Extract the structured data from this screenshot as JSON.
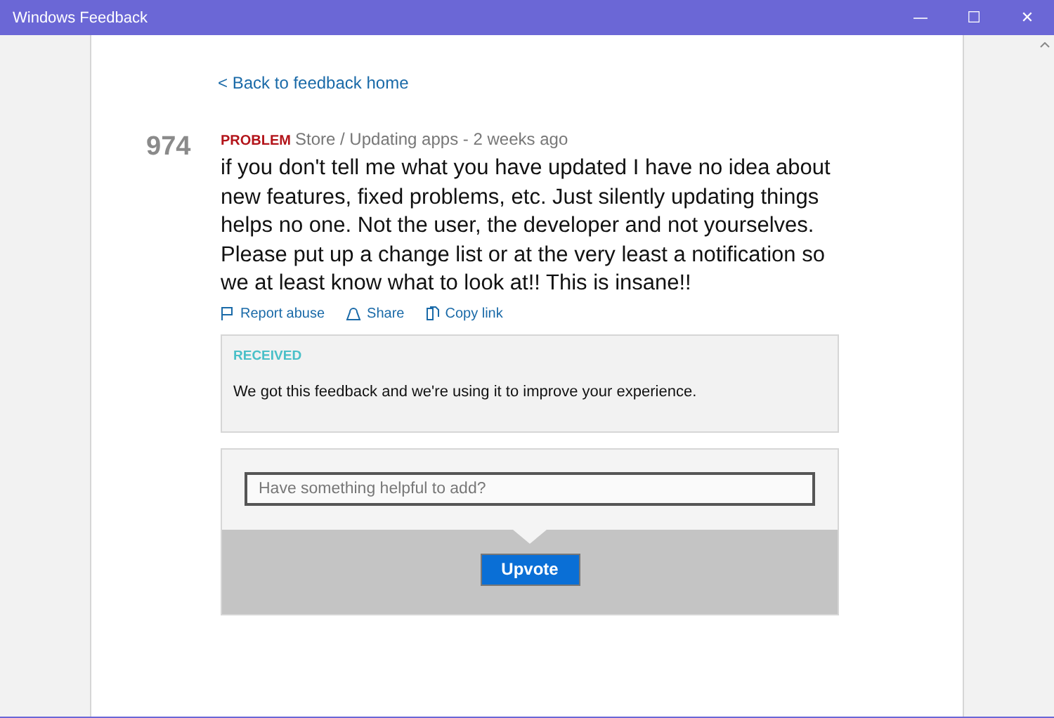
{
  "window": {
    "title": "Windows Feedback",
    "controls": [
      "—",
      "☐",
      "✕"
    ]
  },
  "back_link": "< Back to feedback home",
  "feedback": {
    "votes": "974",
    "category_tag": "PROBLEM",
    "category": "Store / Updating apps - 2 weeks ago",
    "text": "if you don't tell me what you have updated I have no idea about new features, fixed problems, etc. Just silently updating things helps no one. Not the user, the developer and not yourselves. Please put up a change list or at the very least a notification so we at least know what to look at!! This is insane!!",
    "actions": [
      "Report abuse",
      "Share",
      "Copy link"
    ]
  },
  "status": {
    "label": "RECEIVED",
    "message": "We got this feedback and we're using it to improve your experience."
  },
  "comment": {
    "placeholder": "Have something helpful to add?",
    "button": "Upvote"
  }
}
